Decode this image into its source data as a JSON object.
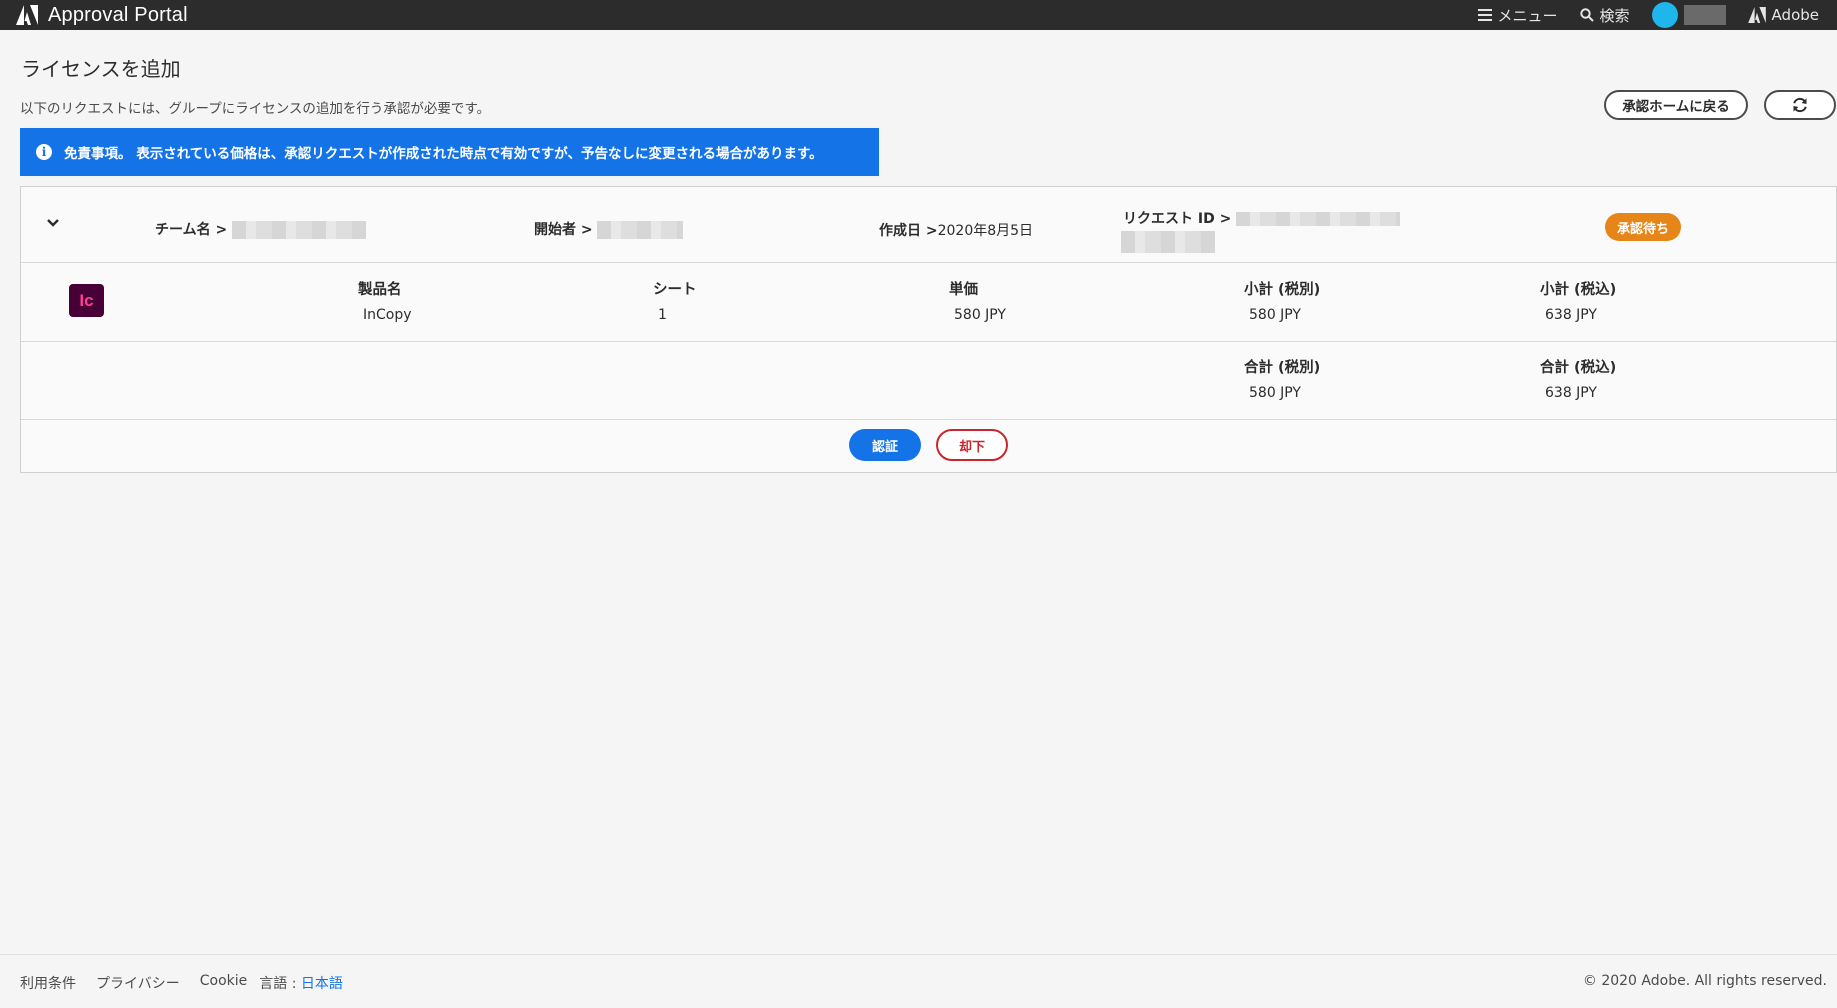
{
  "topbar": {
    "app_title": "Approval Portal",
    "menu_label": "メニュー",
    "search_label": "検索",
    "adobe_label": "Adobe"
  },
  "page": {
    "title": "ライセンスを追加",
    "subtitle": "以下のリクエストには、グループにライセンスの追加を行う承認が必要です。",
    "back_button": "承認ホームに戻る",
    "notice": "免責事項。 表示されている価格は、承認リクエストが作成された時点で有効ですが、予告なしに変更される場合があります。"
  },
  "request": {
    "team_label": "チーム名 >",
    "initiator_label": "開始者 >",
    "created_label": "作成日 >",
    "created_value": "2020年8月5日",
    "request_id_label": "リクエスト ID >",
    "status": "承認待ち"
  },
  "product": {
    "icon_text": "Ic",
    "headers": {
      "name": "製品名",
      "seats": "シート",
      "unit_price": "単価",
      "subtotal_excl": "小計 (税別)",
      "subtotal_incl": "小計 (税込)"
    },
    "row": {
      "name": "InCopy",
      "seats": "1",
      "unit_price": "580 JPY",
      "subtotal_excl": "580 JPY",
      "subtotal_incl": "638 JPY"
    }
  },
  "totals": {
    "total_excl_label": "合計 (税別)",
    "total_excl_value": "580 JPY",
    "total_incl_label": "合計 (税込)",
    "total_incl_value": "638 JPY"
  },
  "actions": {
    "approve": "認証",
    "reject": "却下"
  },
  "footer": {
    "terms": "利用条件",
    "privacy": "プライバシー",
    "cookie": "Cookie",
    "language_label": "言語 :",
    "language_value": "日本語",
    "copyright": "© 2020 Adobe. All rights reserved."
  }
}
